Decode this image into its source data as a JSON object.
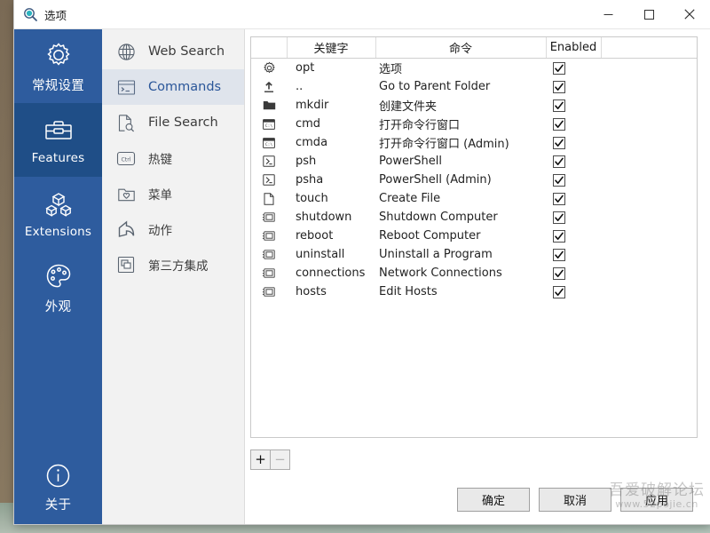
{
  "window": {
    "title": "选项",
    "app_icon": "magnifier-icon",
    "controls": {
      "minimize": "minimize-icon",
      "maximize": "maximize-icon",
      "close": "close-icon"
    }
  },
  "rail": {
    "items": [
      {
        "label": "常规设置",
        "icon": "gear-icon",
        "active": false,
        "cn": true
      },
      {
        "label": "Features",
        "icon": "toolbox-icon",
        "active": true,
        "cn": false
      },
      {
        "label": "Extensions",
        "icon": "blocks-icon",
        "active": false,
        "cn": false
      },
      {
        "label": "外观",
        "icon": "palette-icon",
        "active": false,
        "cn": true
      }
    ],
    "bottom": {
      "label": "关于",
      "icon": "info-icon",
      "active": false,
      "cn": true
    }
  },
  "nav": {
    "items": [
      {
        "label": "Web Search",
        "icon": "globe-icon",
        "active": false,
        "cn": false
      },
      {
        "label": "Commands",
        "icon": "console-icon",
        "active": true,
        "cn": false
      },
      {
        "label": "File Search",
        "icon": "file-search-icon",
        "active": false,
        "cn": false
      },
      {
        "label": "热键",
        "icon": "ctrl-key-icon",
        "active": false,
        "cn": true
      },
      {
        "label": "菜单",
        "icon": "folder-heart-icon",
        "active": false,
        "cn": true
      },
      {
        "label": "动作",
        "icon": "share-icon",
        "active": false,
        "cn": true
      },
      {
        "label": "第三方集成",
        "icon": "windows-stack-icon",
        "active": false,
        "cn": true
      }
    ]
  },
  "table": {
    "headers": {
      "icon": "",
      "keyword": "关键字",
      "command": "命令",
      "enabled": "Enabled",
      "tail": ""
    },
    "rows": [
      {
        "icon": "gear-icon",
        "keyword": "opt",
        "command": "选项",
        "enabled": true
      },
      {
        "icon": "upload-icon",
        "keyword": "..",
        "command": "Go to Parent Folder",
        "enabled": true
      },
      {
        "icon": "folder-icon",
        "keyword": "mkdir",
        "command": "创建文件夹",
        "enabled": true
      },
      {
        "icon": "cmd-icon",
        "keyword": "cmd",
        "command": "打开命令行窗口",
        "enabled": true
      },
      {
        "icon": "cmd-icon",
        "keyword": "cmda",
        "command": "打开命令行窗口 (Admin)",
        "enabled": true
      },
      {
        "icon": "powershell-icon",
        "keyword": "psh",
        "command": "PowerShell",
        "enabled": true
      },
      {
        "icon": "powershell-icon",
        "keyword": "psha",
        "command": "PowerShell (Admin)",
        "enabled": true
      },
      {
        "icon": "file-icon",
        "keyword": "touch",
        "command": "Create File",
        "enabled": true
      },
      {
        "icon": "cpl-icon",
        "keyword": "shutdown",
        "command": "Shutdown Computer",
        "enabled": true
      },
      {
        "icon": "cpl-icon",
        "keyword": "reboot",
        "command": "Reboot Computer",
        "enabled": true
      },
      {
        "icon": "cpl-icon",
        "keyword": "uninstall",
        "command": "Uninstall a Program",
        "enabled": true
      },
      {
        "icon": "cpl-icon",
        "keyword": "connections",
        "command": "Network Connections",
        "enabled": true
      },
      {
        "icon": "cpl-icon",
        "keyword": "hosts",
        "command": "Edit Hosts",
        "enabled": true
      }
    ]
  },
  "list_actions": {
    "add": "+",
    "remove": "−"
  },
  "footer": {
    "ok": "确定",
    "cancel": "取消",
    "apply": "应用"
  },
  "watermark": {
    "top": "吾爱破解论坛",
    "bottom": "www.52pojie.cn"
  },
  "colors": {
    "rail": "#2e5c9e",
    "rail_active": "#1f4e87",
    "nav_bg": "#f2f2f2",
    "nav_active": "#dfe4ec",
    "nav_active_text": "#2a5699",
    "accent": "#2a5699"
  }
}
